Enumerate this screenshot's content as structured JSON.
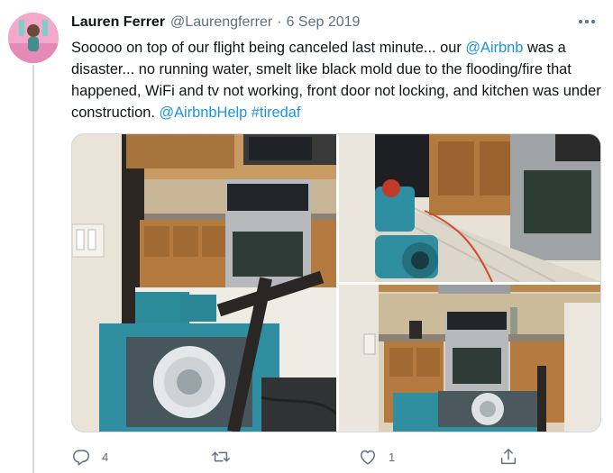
{
  "tweet": {
    "author_name": "Lauren Ferrer",
    "author_handle": "@Laurengferrer",
    "separator": "·",
    "date": "6 Sep 2019",
    "text_part1": "Sooooo on top of our flight being canceled last minute... our ",
    "mention_airbnb": "@Airbnb",
    "text_part2": " was a disaster... no running water, smelt like black mold due to the flooding/fire that happened, WiFi and tv not working, front door not locking, and kitchen was under construction. ",
    "mention_airbnbhelp": "@AirbnbHelp",
    "space": " ",
    "hashtag": "#tiredaf"
  },
  "actions": {
    "reply_count": "4",
    "retweet_count": "",
    "like_count": "1"
  },
  "icons": {
    "more": "more-dots-icon",
    "reply": "reply-icon",
    "retweet": "retweet-icon",
    "like": "heart-icon",
    "share": "share-icon"
  },
  "colors": {
    "link": "#1b95e0",
    "secondary_text": "#5b7083",
    "border": "#d3d9de"
  }
}
